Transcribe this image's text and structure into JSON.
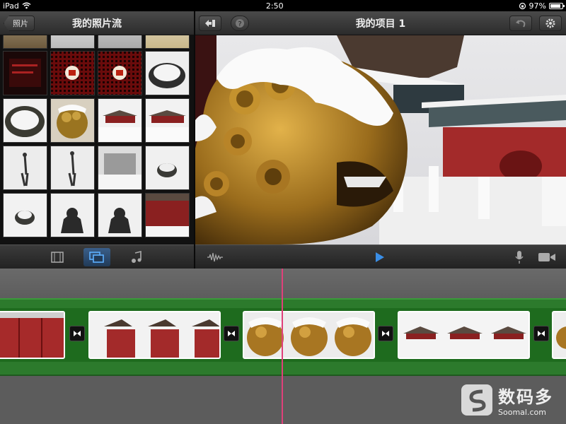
{
  "status": {
    "device": "iPad",
    "time": "2:50",
    "battery": "97%"
  },
  "left": {
    "back_label": "照片",
    "title": "我的照片流",
    "tabs": [
      {
        "icon": "film-icon"
      },
      {
        "icon": "photos-icon",
        "active": true
      },
      {
        "icon": "music-icon"
      }
    ]
  },
  "right": {
    "title": "我的项目 1",
    "toolbar_icons": [
      "project-list-icon",
      "help-icon",
      "undo-icon",
      "settings-icon"
    ],
    "controls": [
      "waveform-icon",
      "play-icon",
      "microphone-icon",
      "camera-icon"
    ]
  },
  "watermark": {
    "cn": "数码多",
    "en": "Soomal.com"
  },
  "colors": {
    "accent": "#3a8ee6",
    "playhead": "#e0407a",
    "track": "#2c7a2c"
  }
}
